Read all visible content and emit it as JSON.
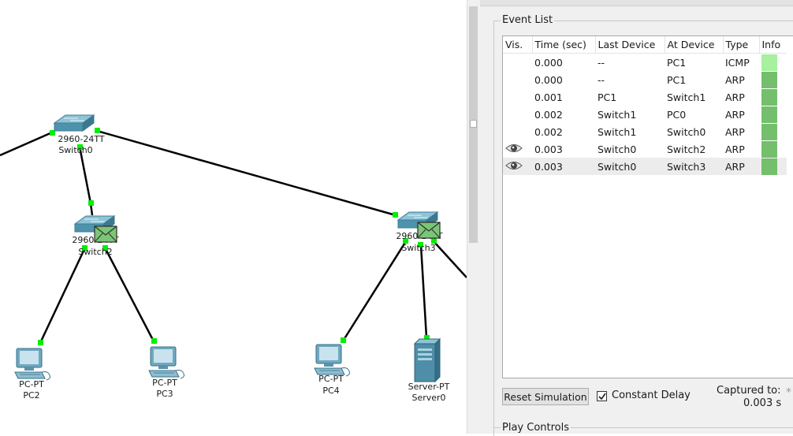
{
  "workspace": {
    "devices": {
      "switch0": {
        "model": "2960-24TT",
        "name": "Switch0"
      },
      "switch2": {
        "model": "2960-24TT",
        "name": "Switch2"
      },
      "switch3": {
        "model": "2960-24TT",
        "name": "Switch3"
      },
      "pc2": {
        "model": "PC-PT",
        "name": "PC2"
      },
      "pc3": {
        "model": "PC-PT",
        "name": "PC3"
      },
      "pc4": {
        "model": "PC-PT",
        "name": "PC4"
      },
      "server0": {
        "model": "Server-PT",
        "name": "Server0"
      }
    },
    "link_dot_color": "#00ee00",
    "envelope_color": "#7cc577"
  },
  "event_list": {
    "title": "Event List",
    "columns": [
      "Vis.",
      "Time (sec)",
      "Last Device",
      "At Device",
      "Type",
      "Info"
    ],
    "rows": [
      {
        "visible": false,
        "time": "0.000",
        "last_device": "--",
        "at_device": "PC1",
        "type": "ICMP",
        "info_color": "#a6f0a0"
      },
      {
        "visible": false,
        "time": "0.000",
        "last_device": "--",
        "at_device": "PC1",
        "type": "ARP",
        "info_color": "#74bf6c"
      },
      {
        "visible": false,
        "time": "0.001",
        "last_device": "PC1",
        "at_device": "Switch1",
        "type": "ARP",
        "info_color": "#74bf6c"
      },
      {
        "visible": false,
        "time": "0.002",
        "last_device": "Switch1",
        "at_device": "PC0",
        "type": "ARP",
        "info_color": "#74bf6c"
      },
      {
        "visible": false,
        "time": "0.002",
        "last_device": "Switch1",
        "at_device": "Switch0",
        "type": "ARP",
        "info_color": "#74bf6c"
      },
      {
        "visible": true,
        "time": "0.003",
        "last_device": "Switch0",
        "at_device": "Switch2",
        "type": "ARP",
        "info_color": "#74bf6c"
      },
      {
        "visible": true,
        "time": "0.003",
        "last_device": "Switch0",
        "at_device": "Switch3",
        "type": "ARP",
        "info_color": "#74bf6c",
        "selected": true
      }
    ],
    "icons": {
      "vis": "eye-icon"
    }
  },
  "controls": {
    "reset_label": "Reset Simulation",
    "constant_delay_label": "Constant Delay",
    "constant_delay_checked": true,
    "captured_label": "Captured to:",
    "captured_value": "0.003 s",
    "captured_star": "*"
  },
  "play_controls": {
    "title": "Play Controls"
  }
}
